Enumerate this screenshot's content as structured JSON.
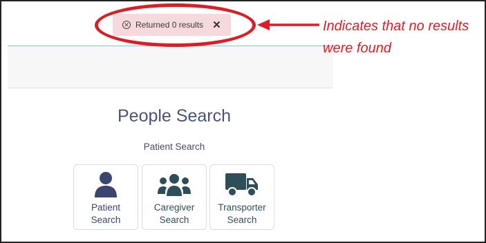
{
  "toast": {
    "message": "Returned 0 results",
    "close_glyph": "✕",
    "status_icon": "x-circle-icon"
  },
  "annotation": {
    "line1": "Indicates that no results",
    "line2": "were found",
    "color": "#e01b24"
  },
  "page": {
    "title": "People Search",
    "section_label": "Patient Search"
  },
  "tiles": [
    {
      "icon": "person-icon",
      "line1": "Patient",
      "line2": "Search",
      "icon_color": "#3b4570"
    },
    {
      "icon": "group-icon",
      "line1": "Caregiver",
      "line2": "Search",
      "icon_color": "#2f4f58"
    },
    {
      "icon": "truck-icon",
      "line1": "Transporter",
      "line2": "Search",
      "icon_color": "#2f4f58"
    }
  ],
  "colors": {
    "toast_bg": "#f6d9dd",
    "accent_rule": "#7fc9cf",
    "title": "#4a5478"
  }
}
